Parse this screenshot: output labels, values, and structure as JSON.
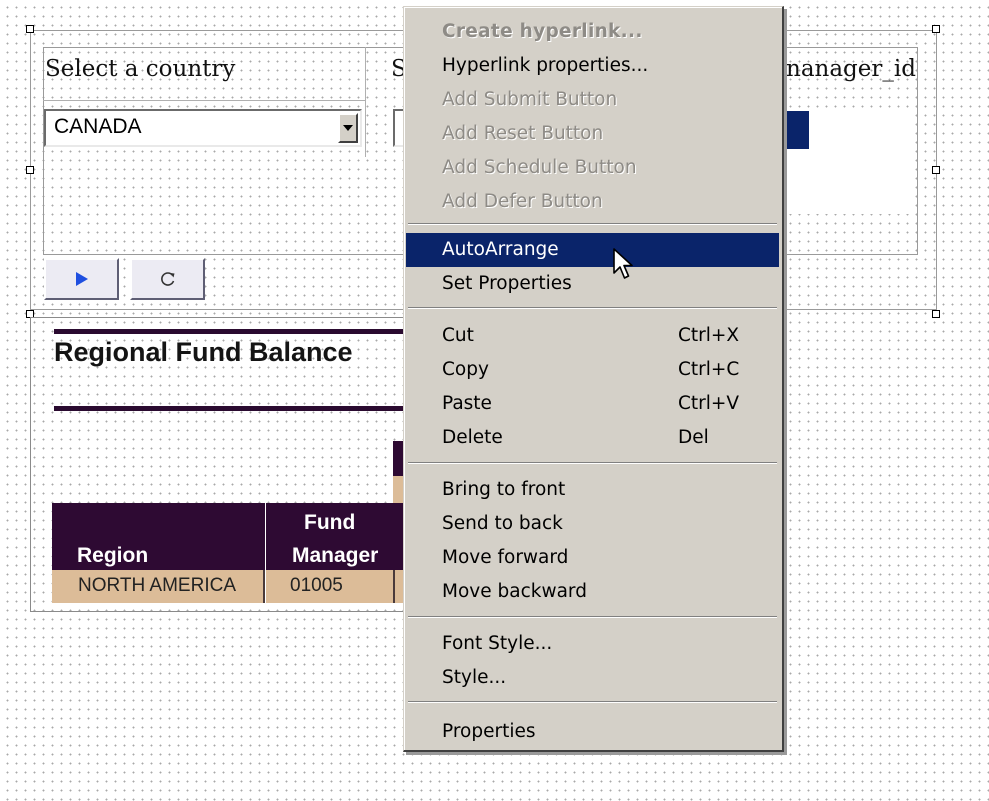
{
  "form": {
    "country_label": "Select a country",
    "country_value": "CANADA",
    "second_label_fragment": "S",
    "third_label_fragment": "nanager_id",
    "run_icon": "play-icon",
    "reset_icon": "reset-icon"
  },
  "report": {
    "title": "Regional Fund Balance",
    "columns": [
      "Region",
      "Fund",
      "Manager"
    ],
    "rows": [
      {
        "region": "NORTH AMERICA",
        "fund_manager": "01005"
      }
    ]
  },
  "context_menu": {
    "groups": [
      [
        {
          "label": "Create hyperlink...",
          "enabled": false,
          "bold": true
        },
        {
          "label": "Hyperlink properties...",
          "enabled": true
        },
        {
          "label": "Add Submit Button",
          "enabled": false
        },
        {
          "label": "Add Reset Button",
          "enabled": false
        },
        {
          "label": "Add Schedule Button",
          "enabled": false
        },
        {
          "label": "Add Defer Button",
          "enabled": false
        }
      ],
      [
        {
          "label": "AutoArrange",
          "enabled": true,
          "selected": true
        },
        {
          "label": "Set Properties",
          "enabled": true
        }
      ],
      [
        {
          "label": "Cut",
          "shortcut": "Ctrl+X",
          "enabled": true
        },
        {
          "label": "Copy",
          "shortcut": "Ctrl+C",
          "enabled": true
        },
        {
          "label": "Paste",
          "shortcut": "Ctrl+V",
          "enabled": true
        },
        {
          "label": "Delete",
          "shortcut": "Del",
          "enabled": true
        }
      ],
      [
        {
          "label": "Bring to front",
          "enabled": true
        },
        {
          "label": "Send to back",
          "enabled": true
        },
        {
          "label": "Move forward",
          "enabled": true
        },
        {
          "label": "Move backward",
          "enabled": true
        }
      ],
      [
        {
          "label": "Font Style...",
          "enabled": true
        },
        {
          "label": "Style...",
          "enabled": true
        }
      ],
      [
        {
          "label": "Properties",
          "enabled": true
        }
      ]
    ]
  },
  "colors": {
    "menu_bg": "#d4d0c8",
    "menu_highlight": "#0a246a",
    "header_bg": "#2e0a33",
    "cell_bg": "#dcbc98",
    "play_blue": "#1f4fe0"
  }
}
